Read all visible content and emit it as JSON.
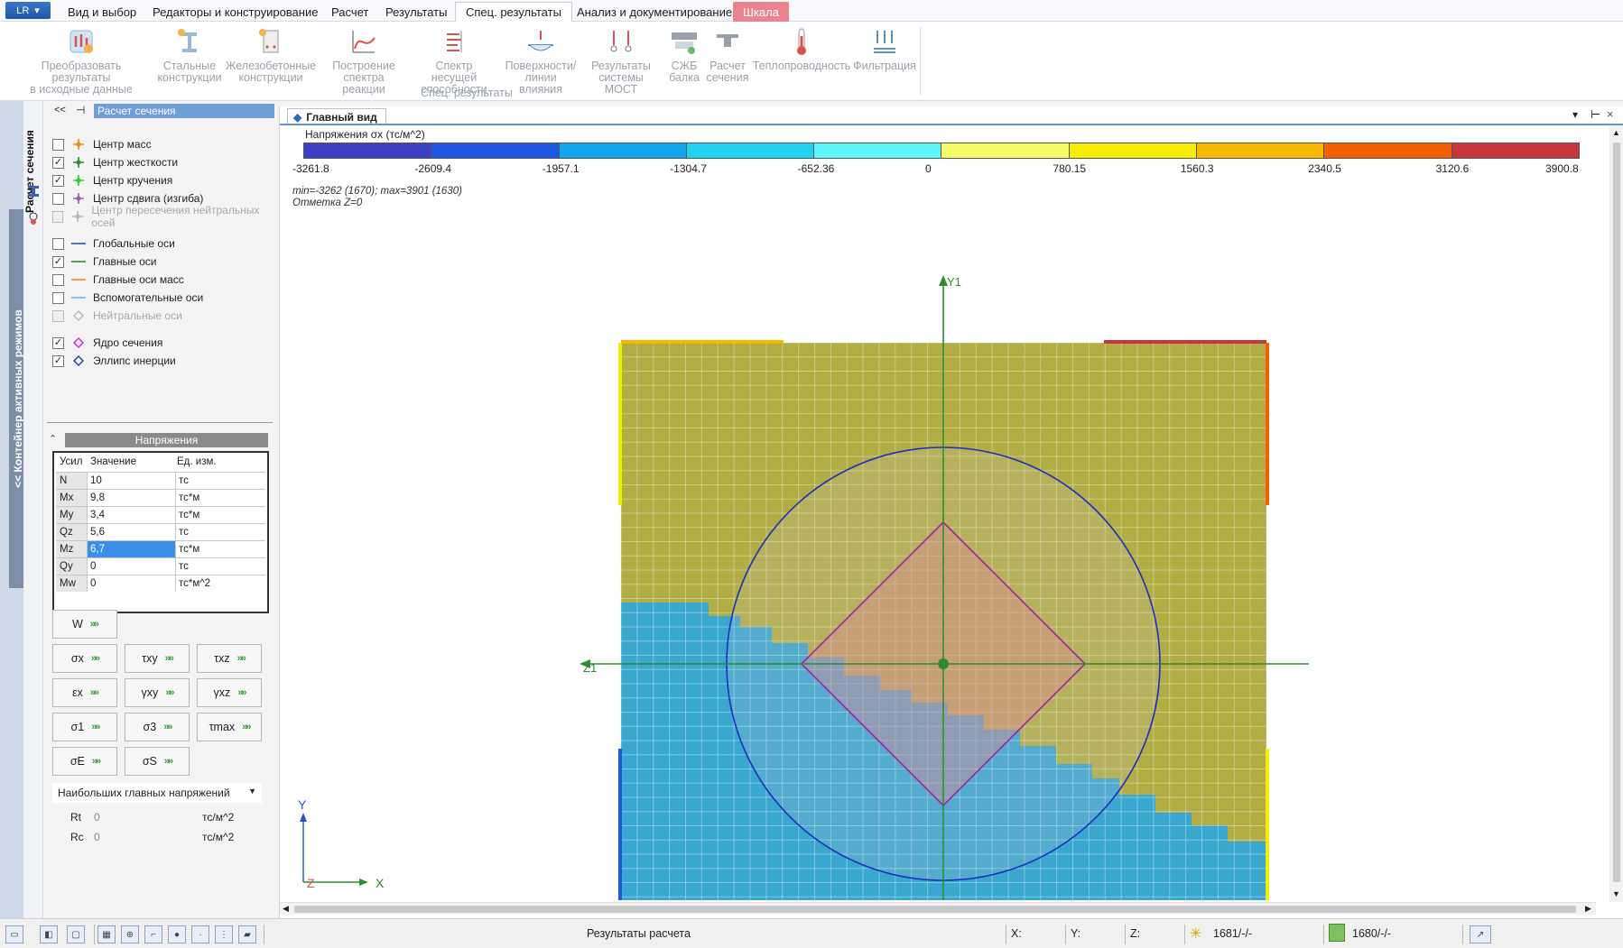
{
  "menu": {
    "app_button": "LR",
    "tabs": [
      {
        "label": "Вид и выбор"
      },
      {
        "label": "Редакторы и конструирование"
      },
      {
        "label": "Расчет"
      },
      {
        "label": "Результаты"
      },
      {
        "label": "Спец. результаты",
        "active": true
      },
      {
        "label": "Анализ и документирование"
      },
      {
        "label": "Шкала"
      }
    ]
  },
  "ribbon": {
    "group_label": "Спец. результаты",
    "buttons": [
      {
        "line1": "Преобразовать результаты",
        "line2": "в исходные данные",
        "icon": "convert-results-icon"
      },
      {
        "line1": "Стальные",
        "line2": "конструкции",
        "icon": "steel-structures-icon"
      },
      {
        "line1": "Железобетонные",
        "line2": "конструкции",
        "icon": "reinforced-concrete-icon"
      },
      {
        "line1": "Построение",
        "line2": "спектра реакции",
        "icon": "response-spectrum-icon"
      },
      {
        "line1": "Спектр несущей",
        "line2": "способности",
        "icon": "capacity-spectrum-icon"
      },
      {
        "line1": "Поверхности/",
        "line2": "линии влияния",
        "icon": "influence-surfaces-icon"
      },
      {
        "line1": "Результаты",
        "line2": "системы МОСТ",
        "icon": "bridge-results-icon"
      },
      {
        "line1": "СЖБ",
        "line2": "балка",
        "icon": "composite-beam-icon"
      },
      {
        "line1": "Расчет",
        "line2": "сечения",
        "icon": "section-calc-icon"
      },
      {
        "line1": "Теплопроводность",
        "line2": "",
        "icon": "thermometer-icon"
      },
      {
        "line1": "Фильтрация",
        "line2": "",
        "icon": "filtration-icon"
      }
    ]
  },
  "side_strip": {
    "container_label": "<< Контейнер активных режимов",
    "section_tab": "Расчет сечения"
  },
  "left_panel": {
    "title": "Расчет сечения",
    "display_options": [
      {
        "label": "Центр масс",
        "checked": false,
        "enabled": true,
        "color": "#f08a1c"
      },
      {
        "label": "Центр жесткости",
        "checked": true,
        "enabled": true,
        "color": "#2e8b2e"
      },
      {
        "label": "Центр кручения",
        "checked": true,
        "enabled": true,
        "color": "#33cc33"
      },
      {
        "label": "Центр сдвига (изгиба)",
        "checked": false,
        "enabled": true,
        "color": "#9b59b6"
      },
      {
        "label": "Центр пересечения нейтральных осей",
        "checked": false,
        "enabled": false,
        "color": "#b8b8b8"
      }
    ],
    "axes_options": [
      {
        "label": "Глобальные оси",
        "checked": false,
        "enabled": true,
        "color": "#2a50d8"
      },
      {
        "label": "Главные оси",
        "checked": true,
        "enabled": true,
        "color": "#2e8b2e"
      },
      {
        "label": "Главные оси масс",
        "checked": false,
        "enabled": true,
        "color": "#f08a1c"
      },
      {
        "label": "Вспомогательные оси",
        "checked": false,
        "enabled": true,
        "color": "#6cb8f0"
      },
      {
        "label": "Нейтральные оси",
        "checked": false,
        "enabled": false,
        "color": "#b8b8b8"
      }
    ],
    "shape_options": [
      {
        "label": "Ядро сечения",
        "checked": true,
        "enabled": true,
        "color": "#d020d0"
      },
      {
        "label": "Эллипс инерции",
        "checked": true,
        "enabled": true,
        "color": "#1a2fc0"
      }
    ],
    "stress_header": "Напряжения",
    "table": {
      "headers": [
        "Усил",
        "Значение",
        "Ед. изм."
      ],
      "rows": [
        {
          "name": "N",
          "value": "10",
          "unit": "тс"
        },
        {
          "name": "Mx",
          "value": "9,8",
          "unit": "тс*м"
        },
        {
          "name": "My",
          "value": "3,4",
          "unit": "тс*м"
        },
        {
          "name": "Qz",
          "value": "5,6",
          "unit": "тс"
        },
        {
          "name": "Mz",
          "value": "6,7",
          "unit": "тс*м",
          "selected": true
        },
        {
          "name": "Qy",
          "value": "0",
          "unit": "тс"
        },
        {
          "name": "Mw",
          "value": "0",
          "unit": "тс*м^2"
        }
      ]
    },
    "result_buttons": {
      "w": "W",
      "grid": [
        [
          "σx",
          "τxy",
          "τxz"
        ],
        [
          "εx",
          "γxy",
          "γxz"
        ],
        [
          "σ1",
          "σ3",
          "τmax"
        ],
        [
          "σE",
          "σS"
        ]
      ]
    },
    "select_value": "Наибольших главных напряжений",
    "resist": [
      {
        "label": "Rt",
        "value": "0",
        "unit": "тс/м^2"
      },
      {
        "label": "Rc",
        "value": "0",
        "unit": "тс/м^2"
      }
    ]
  },
  "view": {
    "tab_label": "Главный вид",
    "scale_title": "Напряжения σx (тс/м^2)",
    "scale_colors": [
      "#3b3fc4",
      "#1f57e0",
      "#12a6ea",
      "#1fd2ef",
      "#5ef6f6",
      "#f8fb68",
      "#f6ee00",
      "#f6b800",
      "#f36000",
      "#c8363c"
    ],
    "scale_ticks": [
      "-3261.8",
      "-2609.4",
      "-1957.1",
      "-1304.7",
      "-652.36",
      "0",
      "780.15",
      "1560.3",
      "2340.5",
      "3120.6",
      "3900.8"
    ],
    "minmax_line1": "min=-3262 (1670); max=3901 (1630)",
    "minmax_line2": "Отметка Z=0",
    "axis_y1": "Y1",
    "axis_z1": "Z1",
    "axis_y": "Y",
    "axis_z": "Z",
    "axis_x": "X",
    "fill_tension": "#b2ad45",
    "fill_compression": "#3aa7cf"
  },
  "status": {
    "label": "Результаты расчета",
    "x_label": "X:",
    "y_label": "Y:",
    "z_label": "Z:",
    "nodes": "1681/-/-",
    "elements": "1680/-/-"
  }
}
